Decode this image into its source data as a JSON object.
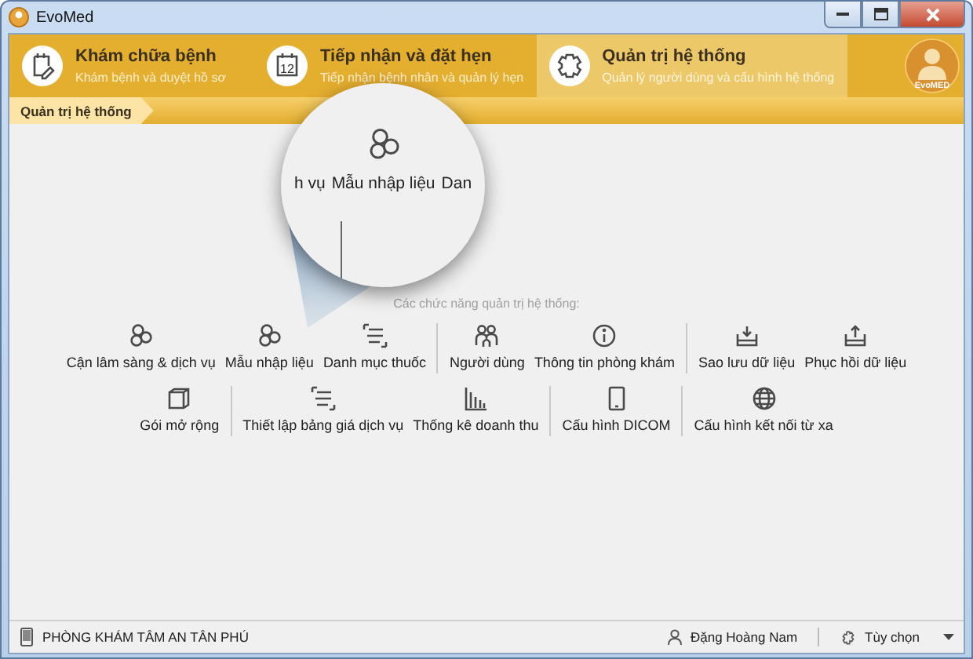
{
  "window": {
    "title": "EvoMed"
  },
  "modules": [
    {
      "kind": "notepad",
      "title": "Khám chữa bệnh",
      "subtitle": "Khám bệnh và duyệt hồ sơ",
      "selected": false
    },
    {
      "kind": "calendar",
      "icon_text": "12",
      "title": "Tiếp nhận và đặt hẹn",
      "subtitle": "Tiếp nhận bệnh nhân và quản lý hẹn",
      "selected": false
    },
    {
      "kind": "gear",
      "title": "Quản trị hệ thống",
      "subtitle": "Quản lý người dùng và cấu hình hệ thống",
      "selected": true
    }
  ],
  "logo_text": "EvoMED",
  "breadcrumb": [
    "Quản trị hệ thống"
  ],
  "section_caption": "Các chức năng quản trị hệ thống:",
  "function_rows": [
    [
      [
        {
          "kind": "circles",
          "label": "Cận lâm sàng & dịch vụ"
        },
        {
          "kind": "circles",
          "label": "Mẫu nhập liệu"
        },
        {
          "kind": "list",
          "label": "Danh mục thuốc"
        }
      ],
      [
        {
          "kind": "people",
          "label": "Người dùng"
        },
        {
          "kind": "info",
          "label": "Thông tin phòng khám"
        }
      ],
      [
        {
          "kind": "download",
          "label": "Sao lưu dữ liệu"
        },
        {
          "kind": "upload",
          "label": "Phục hồi dữ liệu"
        }
      ]
    ],
    [
      [
        {
          "kind": "box",
          "label": "Gói mở rộng"
        }
      ],
      [
        {
          "kind": "list",
          "label": "Thiết lập bảng giá dịch vụ"
        },
        {
          "kind": "chart",
          "label": "Thống kê doanh thu"
        }
      ],
      [
        {
          "kind": "tablet",
          "label": "Cấu hình DICOM"
        }
      ],
      [
        {
          "kind": "globe",
          "label": "Cấu hình kết nối từ xa"
        }
      ]
    ]
  ],
  "magnifier": {
    "left_text": "h vụ",
    "label": "Mẫu nhập liệu",
    "right_text": "Dan"
  },
  "status_bar": {
    "clinic": "PHÒNG KHÁM TÂM AN TÂN PHÚ",
    "user": "Đặng Hoàng Nam",
    "options": "Tùy chọn"
  }
}
